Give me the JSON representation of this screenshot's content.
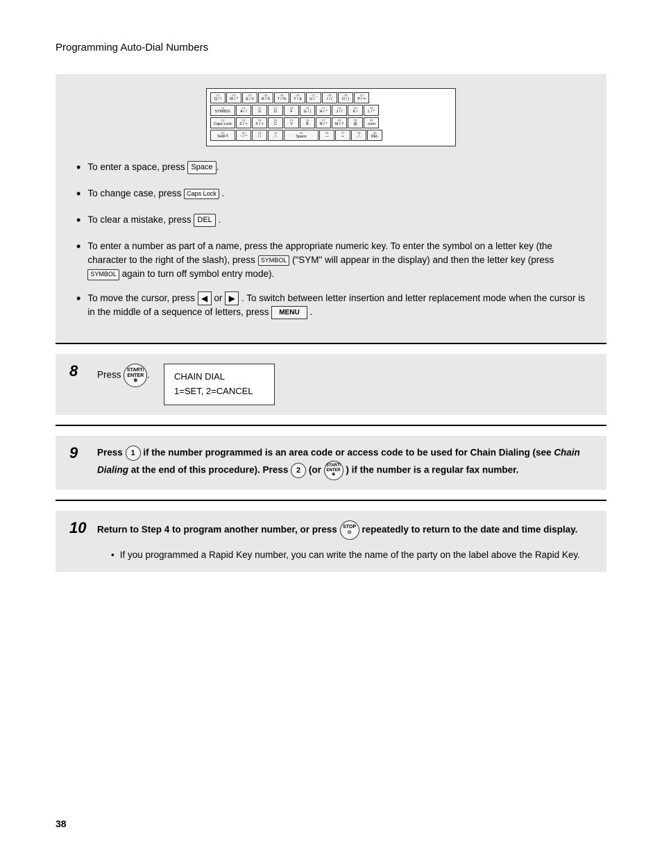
{
  "page": {
    "title": "Programming Auto-Dial Numbers",
    "page_number": "38"
  },
  "keyboard": {
    "rows": [
      {
        "keys": [
          "01 Q/!",
          "02 W/*",
          "03 E/♦",
          "04 R/S",
          "05 T/%",
          "06 Y/&",
          "07 U/¯",
          "08 I/(",
          "09 O/)",
          "10 P/="
        ]
      },
      {
        "keys": [
          "11 SYMBOL",
          "12 A/!",
          "13 S",
          "14 D",
          "15 F",
          "16 G/(/",
          "17 H/*",
          "18 J/!",
          "19 K/",
          "20 L/*"
        ]
      },
      {
        "keys": [
          "21 CapsLock",
          "22 Z/⟨",
          "23 X/⟩",
          "24 C",
          "25 V",
          "26 B",
          "27 N/*",
          "28 M/7",
          "29 @",
          "30 .com"
        ]
      },
      {
        "keys": [
          "31 SHIFT",
          "32 ~/*",
          "33 /\\",
          "34 ,/.",
          "35 Space",
          "36 —",
          "37 +",
          "38 ,/.",
          "39 DEL"
        ]
      }
    ]
  },
  "bullets": {
    "space": "To enter a space, press",
    "space_key": "Space",
    "case": "To change case, press",
    "case_key": "Caps Lock",
    "clear": "To clear a mistake, press",
    "clear_key": "DEL",
    "number_p1": "To enter a number as part of a name, press the appropriate numeric key. To enter the symbol on a letter key (the character to the right of the slash), press",
    "symbol_key": "SYMBOL",
    "number_p2": "(\"SYM\" will appear in the display) and then the letter key (press",
    "number_p3": "again to turn off symbol entry mode).",
    "cursor_p1": "To move the cursor, press",
    "cursor_or": "or",
    "cursor_p2": ". To switch between letter insertion and letter replacement mode when the cursor is in the middle of a sequence of letters, press",
    "cursor_end": "."
  },
  "steps": {
    "step8": {
      "number": "8",
      "text_before": "Press",
      "key_label": "START/\nENTER\n⊕",
      "display": {
        "line1": "CHAIN DIAL",
        "line2": "1=SET, 2=CANCEL"
      }
    },
    "step9": {
      "number": "9",
      "bold_text": "Press",
      "key_number": "1",
      "text1": "if the number programmed is an area code or access code to be used for Chain Dialing (see",
      "italic_term": "Chain Dialing",
      "text2": "at the end of this procedure). Press",
      "key_number2": "2",
      "text3": "(or",
      "text4": ") if the number is a regular fax number."
    },
    "step10": {
      "number": "10",
      "bold_text1": "Return to Step 4 to program another number, or press",
      "key_label": "STOP\n⊙",
      "bold_text2": "repeatedly to return to the date and time display.",
      "sub_bullet": "If you programmed a Rapid Key number, you can write the name of the party on the label above the Rapid Key."
    }
  }
}
